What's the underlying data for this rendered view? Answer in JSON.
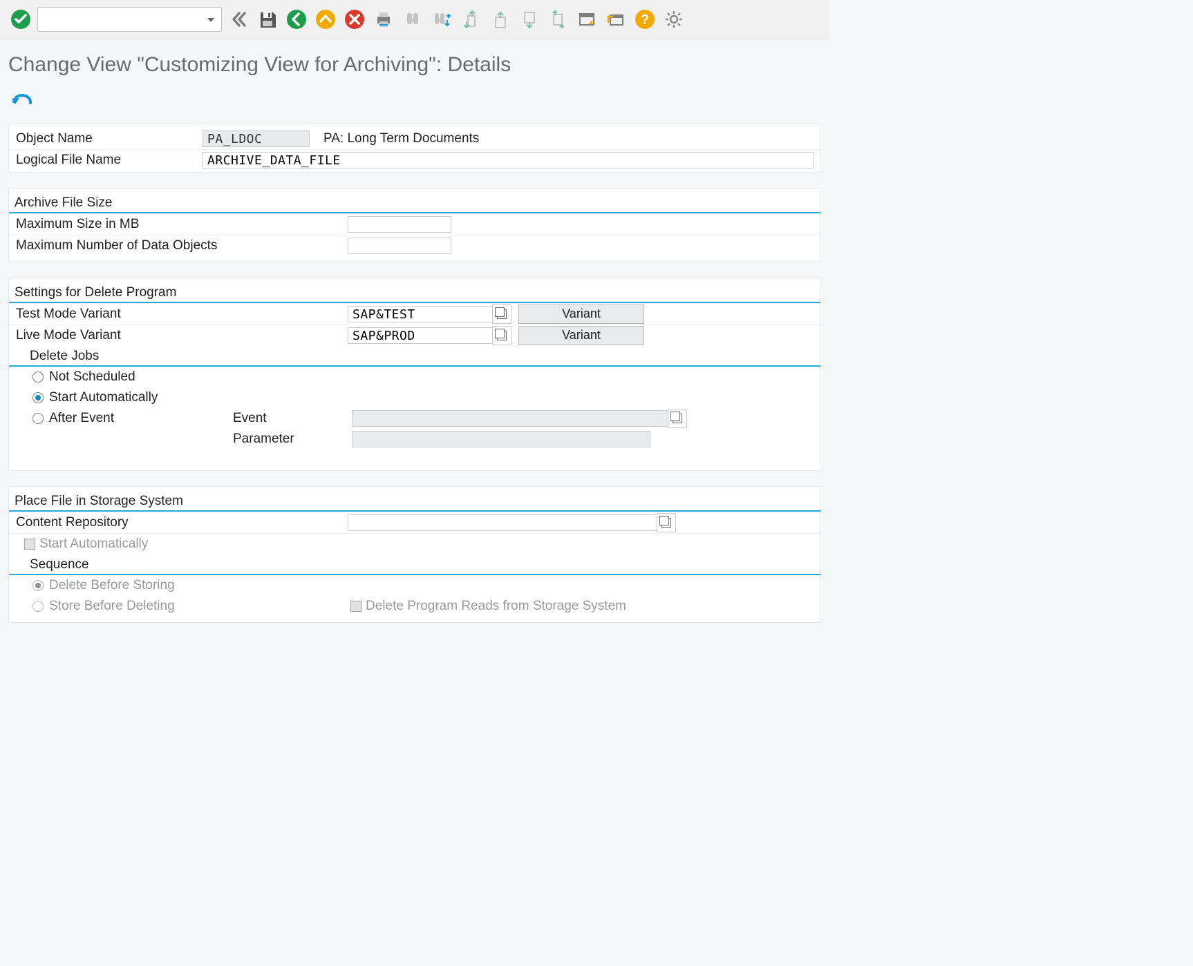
{
  "toolbar": {
    "combo_value": ""
  },
  "page_title": "Change View \"Customizing View for Archiving\": Details",
  "header": {
    "object_name_label": "Object Name",
    "object_name_value": "PA_LDOC",
    "object_name_desc": "PA: Long Term Documents",
    "logical_file_label": "Logical File Name",
    "logical_file_value": "ARCHIVE_DATA_FILE"
  },
  "archive_size": {
    "section": "Archive File Size",
    "max_mb_label": "Maximum Size in MB",
    "max_mb_value": "",
    "max_obj_label": "Maximum Number of Data Objects",
    "max_obj_value": ""
  },
  "delete_prog": {
    "section": "Settings for Delete Program",
    "test_label": "Test Mode Variant",
    "test_value": "SAP&TEST",
    "live_label": "Live Mode Variant",
    "live_value": "SAP&PROD",
    "variant_btn": "Variant",
    "jobs_section": "Delete Jobs",
    "opt_not_scheduled": "Not Scheduled",
    "opt_start_auto": "Start Automatically",
    "opt_after_event": "After Event",
    "event_label": "Event",
    "event_value": "",
    "param_label": "Parameter",
    "param_value": ""
  },
  "storage": {
    "section": "Place File in Storage System",
    "repo_label": "Content Repository",
    "repo_value": "",
    "start_auto_label": "Start Automatically",
    "seq_section": "Sequence",
    "opt_delete_before": "Delete Before Storing",
    "opt_store_before": "Store Before Deleting",
    "reads_label": "Delete Program Reads from Storage System",
    "selected": "delete_before"
  }
}
